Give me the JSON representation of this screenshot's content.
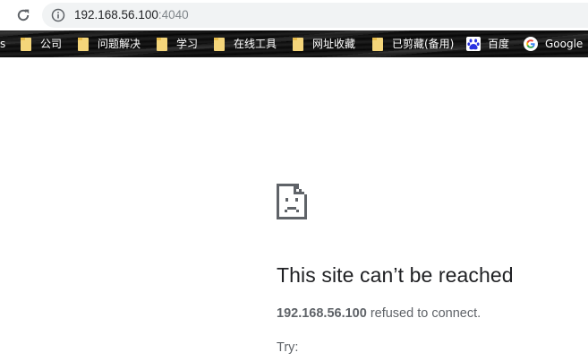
{
  "address_bar": {
    "host": "192.168.56.100",
    "port": ":4040"
  },
  "bookmarks_bar": {
    "partial_item": "s",
    "items": [
      {
        "label": "公司",
        "icon": "folder-icon"
      },
      {
        "label": "问题解决",
        "icon": "folder-icon"
      },
      {
        "label": "学习",
        "icon": "folder-icon"
      },
      {
        "label": "在线工具",
        "icon": "folder-icon"
      },
      {
        "label": "网址收藏",
        "icon": "folder-icon"
      },
      {
        "label": "已剪藏(备用)",
        "icon": "folder-icon"
      },
      {
        "label": "百度",
        "icon": "baidu-paw-icon"
      },
      {
        "label": "Google",
        "icon": "google-g-icon"
      }
    ]
  },
  "error": {
    "icon": "sad-document-icon",
    "title": "This site can’t be reached",
    "host": "192.168.56.100",
    "message": " refused to connect.",
    "try_label": "Try:"
  }
}
